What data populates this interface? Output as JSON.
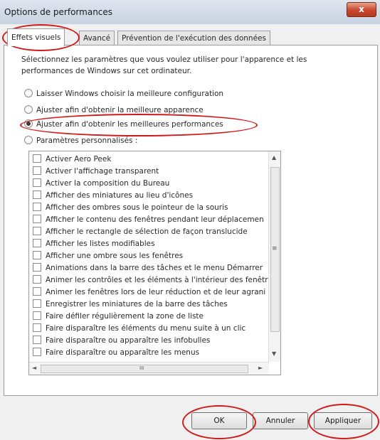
{
  "window": {
    "title": "Options de performances",
    "close_glyph": "x"
  },
  "tabs": [
    {
      "label": "Effets visuels",
      "active": true
    },
    {
      "label": "Avancé",
      "active": false
    },
    {
      "label": "Prévention de l'exécution des données",
      "active": false
    }
  ],
  "description": "Sélectionnez les paramètres que vous voulez utiliser pour l'apparence et les performances de Windows sur cet ordinateur.",
  "radios": [
    {
      "label": "Laisser Windows choisir la meilleure configuration",
      "checked": false
    },
    {
      "label": "Ajuster afin d'obtenir la meilleure apparence",
      "checked": false
    },
    {
      "label": "Ajuster afin d'obtenir les meilleures performances",
      "checked": true
    },
    {
      "label": "Paramètres personnalisés :",
      "checked": false
    }
  ],
  "options": [
    "Activer Aero Peek",
    "Activer l'affichage transparent",
    "Activer la composition du Bureau",
    "Afficher des miniatures au lieu d'icônes",
    "Afficher des ombres sous le pointeur de la souris",
    "Afficher le contenu des fenêtres pendant leur déplacemen",
    "Afficher le rectangle de sélection de façon translucide",
    "Afficher les listes modifiables",
    "Afficher une ombre sous les fenêtres",
    "Animations dans la barre des tâches et le menu Démarrer",
    "Animer les contrôles et les éléments à l'intérieur des fenêtr",
    "Animer les fenêtres lors de leur réduction et de leur agrani",
    "Enregistrer les miniatures de la barre des tâches",
    "Faire défiler régulièrement la zone de liste",
    "Faire disparaître les éléments du menu suite à un clic",
    "Faire disparaître ou apparaître les infobulles",
    "Faire disparaître ou apparaître les menus"
  ],
  "scroll_glyphs": {
    "up": "▲",
    "down": "▼",
    "left": "◄",
    "right": "►",
    "h_grip": "III",
    "v_grip": "≡"
  },
  "buttons": {
    "ok": "OK",
    "cancel": "Annuler",
    "apply": "Appliquer"
  },
  "annotation_color": "#d11a1a"
}
